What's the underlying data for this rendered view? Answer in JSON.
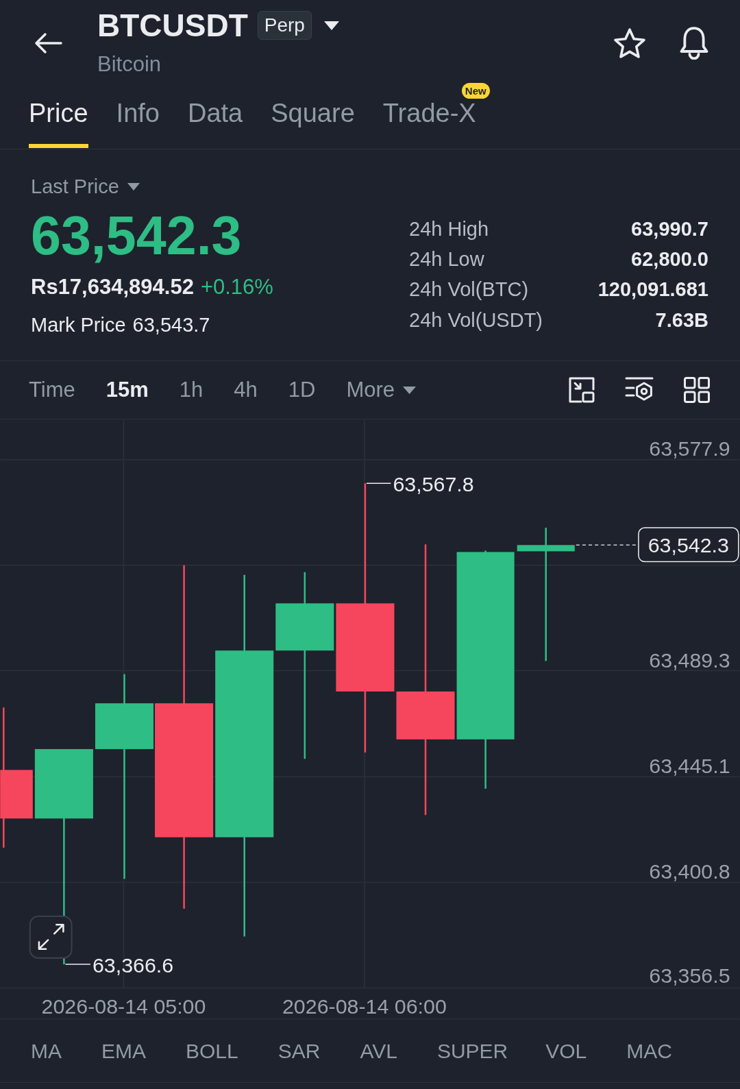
{
  "header": {
    "symbol": "BTCUSDT",
    "contract_badge": "Perp",
    "name": "Bitcoin"
  },
  "tabs": [
    {
      "label": "Price",
      "selected": true
    },
    {
      "label": "Info",
      "selected": false
    },
    {
      "label": "Data",
      "selected": false
    },
    {
      "label": "Square",
      "selected": false
    },
    {
      "label": "Trade-X",
      "selected": false,
      "badge": "New"
    }
  ],
  "ticker": {
    "price_label": "Last Price",
    "last_price": "63,542.3",
    "local_price": "Rs17,634,894.52",
    "change": "+0.16%",
    "mark_price_label": "Mark Price",
    "mark_price": "63,543.7",
    "stats": [
      {
        "label": "24h High",
        "value": "63,990.7"
      },
      {
        "label": "24h Low",
        "value": "62,800.0"
      },
      {
        "label": "24h Vol(BTC)",
        "value": "120,091.681"
      },
      {
        "label": "24h Vol(USDT)",
        "value": "7.63B"
      }
    ]
  },
  "intervals": [
    {
      "label": "Time",
      "kind": "interval",
      "selected": false
    },
    {
      "label": "15m",
      "kind": "interval",
      "selected": true
    },
    {
      "label": "1h",
      "kind": "interval",
      "selected": false
    },
    {
      "label": "4h",
      "kind": "interval",
      "selected": false
    },
    {
      "label": "1D",
      "kind": "interval",
      "selected": false
    },
    {
      "label": "More",
      "kind": "dropdown",
      "selected": false
    }
  ],
  "chart": {
    "y_axis_labels": [
      "63,577.9",
      "63,489.3",
      "63,445.1",
      "63,400.8",
      "63,356.5"
    ],
    "high_marker": "63,567.8",
    "low_marker": "63,366.6",
    "last_price_tag": "63,542.3",
    "time_labels": [
      "2026-08-14 05:00",
      "2026-08-14 06:00"
    ]
  },
  "indicators": {
    "main": [
      "MA",
      "EMA",
      "BOLL",
      "SAR",
      "AVL",
      "SUPER"
    ],
    "sub": [
      "VOL",
      "MAC"
    ]
  }
}
